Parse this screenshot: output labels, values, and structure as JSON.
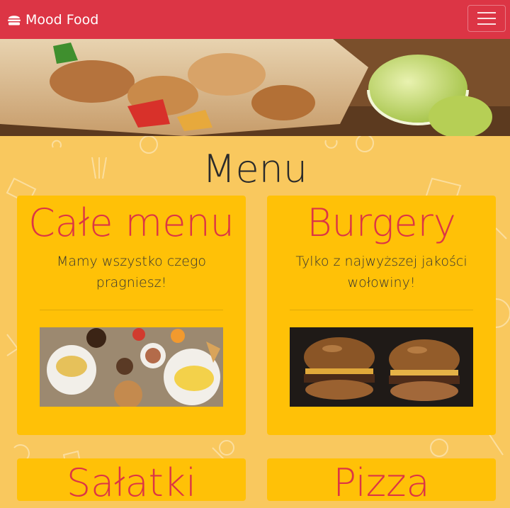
{
  "navbar": {
    "brand": "Mood Food",
    "brand_icon": "burger-icon",
    "toggler_icon": "hamburger-menu-icon",
    "color": "#dc3545"
  },
  "section": {
    "title": "Menu"
  },
  "cards": [
    {
      "title": "Całe menu",
      "text": "Mamy wszystko czego pragniesz!"
    },
    {
      "title": "Burgery",
      "text": "Tylko z najwyższej jakości wołowiny!"
    },
    {
      "title": "Sałatki"
    },
    {
      "title": "Pizza"
    }
  ],
  "colors": {
    "accent": "#dc3545",
    "card": "#ffc107",
    "background": "#f9c85e"
  }
}
